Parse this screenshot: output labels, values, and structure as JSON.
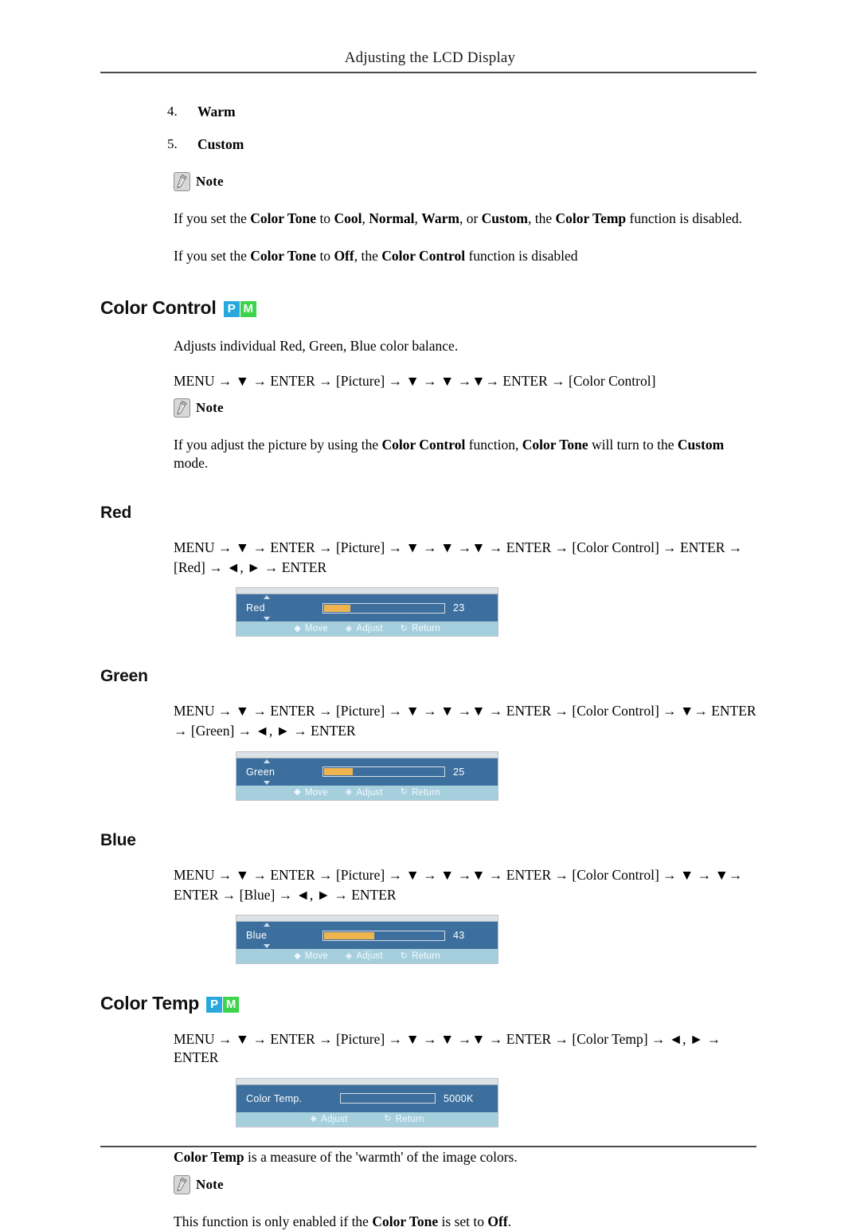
{
  "header": {
    "title": "Adjusting the LCD Display"
  },
  "list": [
    {
      "num": "4.",
      "label": "Warm"
    },
    {
      "num": "5.",
      "label": "Custom"
    }
  ],
  "notes": {
    "label": "Note",
    "note1_line1": "If you set the Color Tone to Cool, Normal, Warm, or Custom, the Color Temp function is disabled.",
    "note1_line2": "If you set the Color Tone to Off, the Color Control function is disabled",
    "note2": "If you adjust the picture by using the Color Control function, Color Tone will turn to the Custom mode.",
    "note3": "This function is only enabled if the Color Tone is set to Off."
  },
  "sections": {
    "color_control": {
      "title": "Color Control",
      "badges": [
        "P",
        "M"
      ],
      "description": "Adjusts individual Red, Green, Blue color balance.",
      "menupath": "MENU → ▼ → ENTER → [Picture] → ▼ → ▼ →▼→ ENTER → [Color Control]"
    },
    "red": {
      "title": "Red",
      "menupath_line1": "MENU → ▼ → ENTER → [Picture] → ▼ → ▼ →▼ → ENTER → [Color Control] → ENTER →",
      "menupath_line2": "[Red] → ◄, ► → ENTER",
      "osd": {
        "label": "Red",
        "value": "23",
        "fill_percent": 23,
        "footer": [
          {
            "glyph": "updown",
            "label": "Move"
          },
          {
            "glyph": "leftright",
            "label": "Adjust"
          },
          {
            "glyph": "return",
            "label": "Return"
          }
        ]
      }
    },
    "green": {
      "title": "Green",
      "menupath_line1": "MENU → ▼ → ENTER → [Picture] → ▼ → ▼ →▼ → ENTER → [Color Control] → ▼→ ENTER",
      "menupath_line2": "→ [Green] → ◄, ► → ENTER",
      "osd": {
        "label": "Green",
        "value": "25",
        "fill_percent": 25,
        "footer": [
          {
            "glyph": "updown",
            "label": "Move"
          },
          {
            "glyph": "leftright",
            "label": "Adjust"
          },
          {
            "glyph": "return",
            "label": "Return"
          }
        ]
      }
    },
    "blue": {
      "title": "Blue",
      "menupath_line1": "MENU → ▼ → ENTER → [Picture] → ▼ → ▼ →▼ → ENTER → [Color Control] → ▼ → ▼→",
      "menupath_line2": "ENTER → [Blue] → ◄, ► → ENTER",
      "osd": {
        "label": "Blue",
        "value": "43",
        "fill_percent": 43,
        "footer": [
          {
            "glyph": "updown",
            "label": "Move"
          },
          {
            "glyph": "leftright",
            "label": "Adjust"
          },
          {
            "glyph": "return",
            "label": "Return"
          }
        ]
      }
    },
    "color_temp": {
      "title": "Color Temp",
      "badges": [
        "P",
        "M"
      ],
      "menupath": "MENU → ▼ → ENTER → [Picture] → ▼ → ▼ →▼ → ENTER → [Color Temp] → ◄, ► → ENTER",
      "osd": {
        "label": "Color  Temp.",
        "value": "5000K",
        "fill_percent": 0,
        "footer": [
          {
            "glyph": "leftright",
            "label": "Adjust"
          },
          {
            "glyph": "return",
            "label": "Return"
          }
        ]
      },
      "description": "Color Temp is a measure of the 'warmth' of the image colors."
    }
  },
  "colors": {
    "badge_p": "#29a8dd",
    "badge_m": "#3bd44a",
    "osd_bg": "#3d6f9e",
    "osd_fill": "#efb450",
    "osd_footer": "#a6cfdd"
  }
}
